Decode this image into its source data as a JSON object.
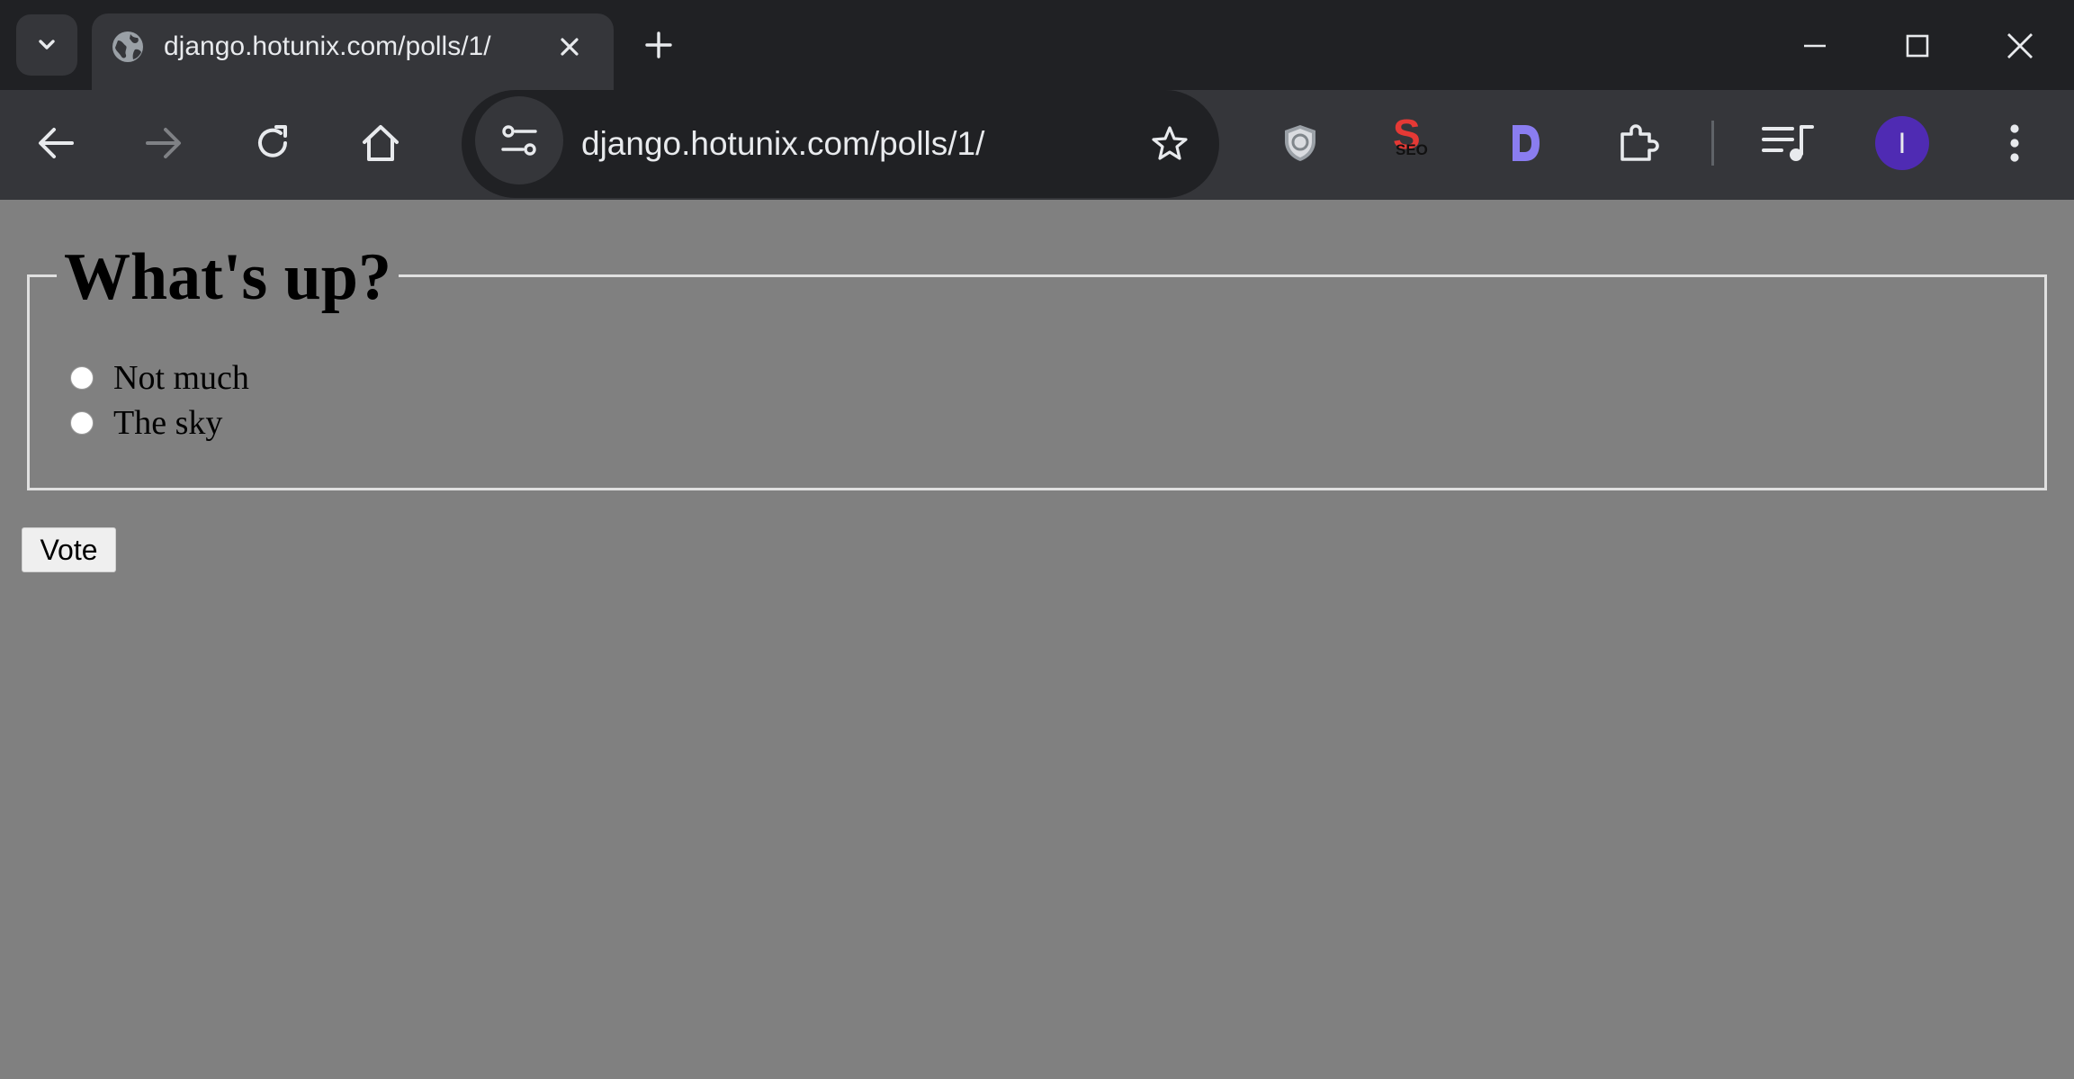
{
  "browser": {
    "tab": {
      "title": "django.hotunix.com/polls/1/"
    },
    "address_bar": {
      "url": "django.hotunix.com/polls/1/"
    },
    "profile": {
      "initial": "I",
      "color": "#4f2bb3"
    },
    "extensions": {
      "seo_letter": "S",
      "seo_text": "SEO",
      "d_letter": "D"
    },
    "icons": [
      "tab-search-icon",
      "globe-icon",
      "close-icon",
      "plus-icon",
      "minimize-icon",
      "maximize-icon",
      "window-close-icon",
      "back-icon",
      "forward-icon",
      "reload-icon",
      "home-icon",
      "site-info-icon",
      "bookmark-star-icon",
      "shield-extension-icon",
      "seo-extension-icon",
      "d-extension-icon",
      "extensions-puzzle-icon",
      "media-controls-icon",
      "menu-icon"
    ]
  },
  "page": {
    "question": "What's up?",
    "choices": [
      {
        "label": "Not much",
        "selected": false
      },
      {
        "label": "The sky",
        "selected": false
      }
    ],
    "vote_label": "Vote",
    "background_color": "#808080"
  }
}
